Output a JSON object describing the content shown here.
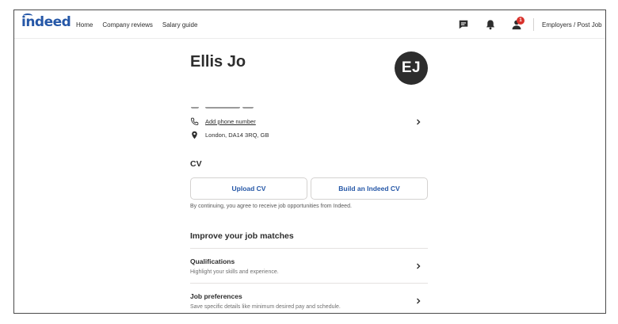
{
  "header": {
    "logo": "indeed",
    "nav": [
      "Home",
      "Company reviews",
      "Salary guide"
    ],
    "notification_count": "1",
    "employers_link": "Employers / Post Job"
  },
  "profile": {
    "name": "Ellis Jo",
    "initials": "EJ",
    "phone_link": "Add phone number",
    "location": "London, DA14 3RQ, GB"
  },
  "cv": {
    "title": "CV",
    "upload_label": "Upload CV",
    "build_label": "Build an Indeed CV",
    "consent": "By continuing, you agree to receive job opportunities from Indeed."
  },
  "improve": {
    "title": "Improve your job matches",
    "items": [
      {
        "title": "Qualifications",
        "desc": "Highlight your skills and experience."
      },
      {
        "title": "Job preferences",
        "desc": "Save specific details like minimum desired pay and schedule."
      }
    ]
  },
  "colors": {
    "brand": "#2557a7",
    "badge": "#d9312b",
    "avatar": "#2d2d2d"
  },
  "icons": [
    "message-icon",
    "bell-icon",
    "user-icon",
    "phone-icon",
    "location-pin-icon",
    "chevron-right-icon"
  ]
}
